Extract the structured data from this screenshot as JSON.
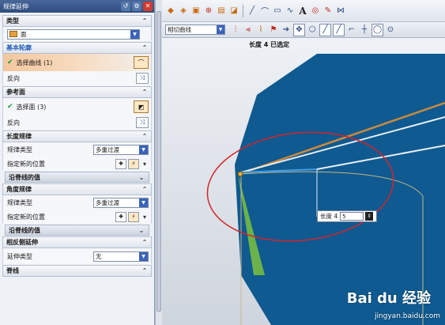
{
  "dialog": {
    "title": "规律延伸",
    "type_section": {
      "label": "类型",
      "value": "面"
    },
    "base_profile": {
      "label": "基本轮廓",
      "select_label": "选择曲线 (1)",
      "reverse_label": "反向"
    },
    "reference_face": {
      "label": "参考面",
      "select_label": "选择面 (3)",
      "reverse_label": "反向"
    },
    "length_law": {
      "label": "长度规律",
      "law_type_label": "规律类型",
      "law_type_value": "多重过渡",
      "new_pos_label": "指定新的位置",
      "spine_values_label": "沿脊线的值"
    },
    "angle_law": {
      "label": "角度规律",
      "law_type_label": "规律类型",
      "law_type_value": "多重过渡",
      "new_pos_label": "指定新的位置",
      "spine_values_label": "沿脊线的值"
    },
    "opposite_extend": {
      "label": "相反侧延伸",
      "extend_type_label": "延伸类型",
      "extend_type_value": "无"
    },
    "spine": {
      "label": "脊线"
    }
  },
  "toolbar": {
    "filter_value": "相切曲线"
  },
  "graphics": {
    "status_text": "长度 4 已选定",
    "length_input": {
      "label": "长度 4",
      "value": "5"
    }
  },
  "watermark": {
    "brand": "Bai du 经验",
    "url": "jingyan.baidu.com"
  },
  "colors": {
    "surface": "#0f5a90",
    "green_face": "#6cb24a",
    "selection_ring": "#d4242a",
    "curve_orange": "#c98a3e",
    "curve_white": "#e8eef5",
    "accent_blue": "#3a64b8"
  }
}
